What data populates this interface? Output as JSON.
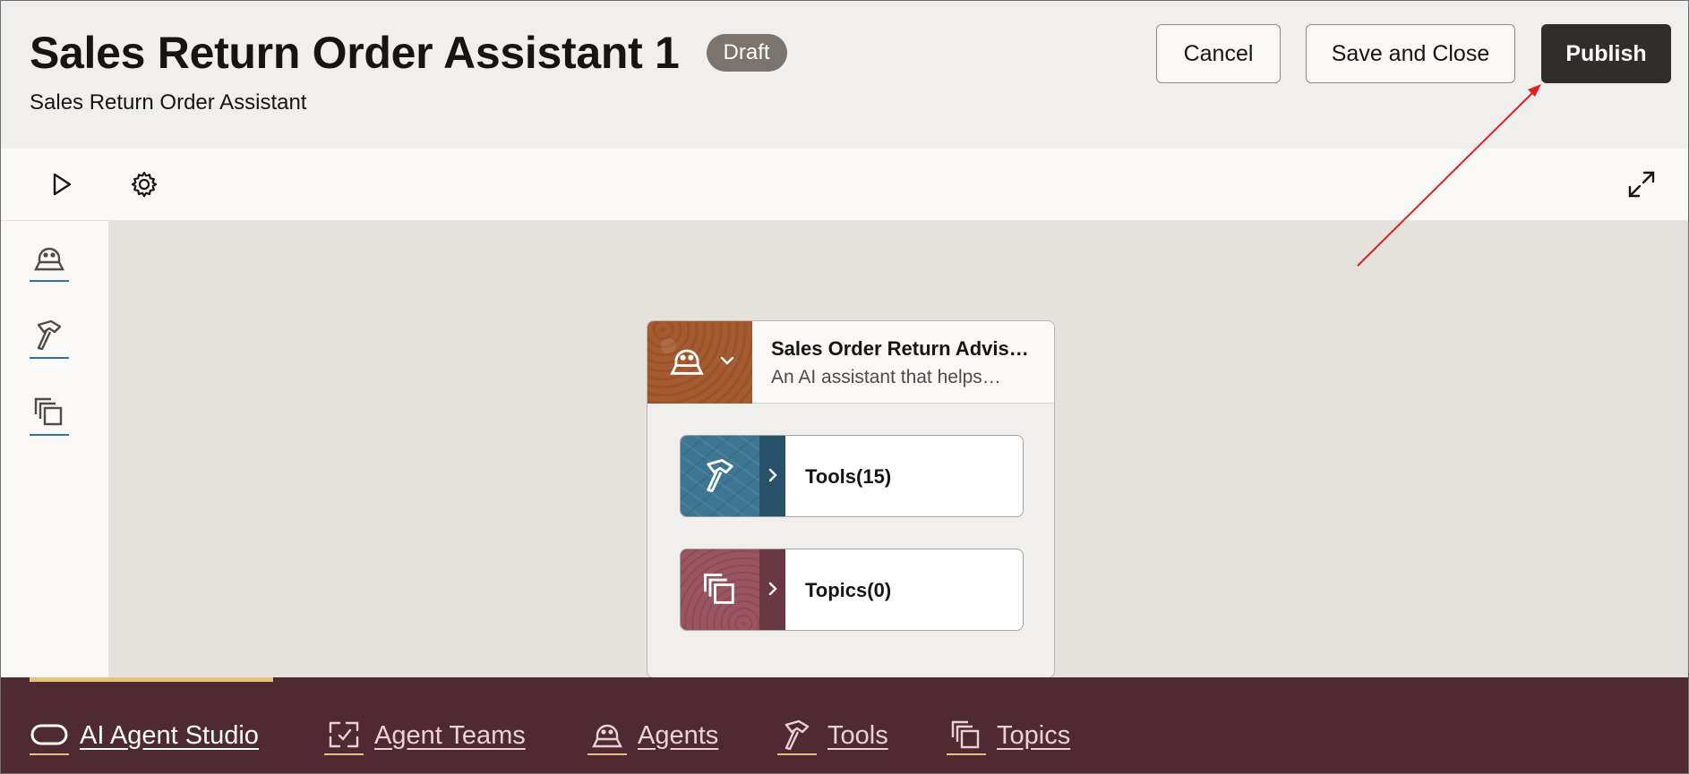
{
  "header": {
    "title": "Sales Return Order Assistant 1",
    "status_badge": "Draft",
    "subtitle": "Sales Return Order Assistant",
    "buttons": {
      "cancel": "Cancel",
      "save_and_close": "Save and Close",
      "publish": "Publish"
    }
  },
  "toolbar": {
    "icons": [
      "play-icon",
      "gear-icon",
      "expand-icon"
    ]
  },
  "left_rail": {
    "icons": [
      "agent-icon",
      "tools-hammer-icon",
      "topics-stack-icon"
    ]
  },
  "canvas": {
    "agent": {
      "name": "Sales Order Return Advis…",
      "description": "An AI assistant that helps…",
      "icon": "agent-icon"
    },
    "tools_card": {
      "label": "Tools(15)",
      "icon": "tools-hammer-icon"
    },
    "topics_card": {
      "label": "Topics(0)",
      "icon": "topics-stack-icon"
    }
  },
  "bottom_nav": {
    "items": [
      {
        "label": "AI Agent Studio",
        "icon": "studio-pill-icon",
        "active": true
      },
      {
        "label": "Agent Teams",
        "icon": "agent-teams-icon"
      },
      {
        "label": "Agents",
        "icon": "agent-icon"
      },
      {
        "label": "Tools",
        "icon": "tools-hammer-icon"
      },
      {
        "label": "Topics",
        "icon": "topics-stack-icon"
      }
    ]
  },
  "colors": {
    "publish_bg": "#312d2a",
    "draft_badge": "#7a736e",
    "agent_tile": "#a65a30",
    "tools_tile": "#3d7693",
    "topics_tile": "#9a5462",
    "bottom_nav_bg": "#4f2a33",
    "nav_accent": "#e9c27a",
    "annotation_arrow": "#e0201c"
  }
}
